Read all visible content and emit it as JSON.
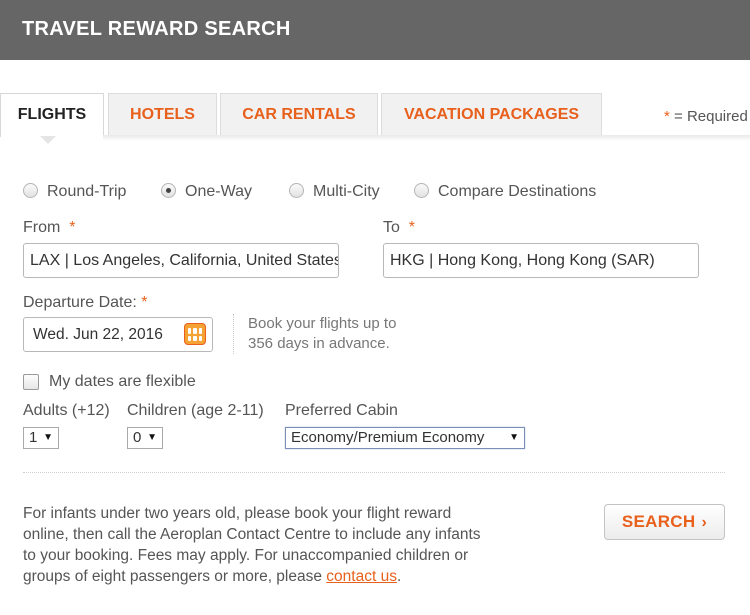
{
  "header": {
    "title": "TRAVEL REWARD SEARCH"
  },
  "tabs": [
    {
      "label": "FLIGHTS",
      "active": true
    },
    {
      "label": "HOTELS",
      "active": false
    },
    {
      "label": "CAR RENTALS",
      "active": false
    },
    {
      "label": "VACATION PACKAGES",
      "active": false
    }
  ],
  "required_note": {
    "star": "*",
    "text": " = Required"
  },
  "trip_types": [
    {
      "label": "Round-Trip",
      "checked": false
    },
    {
      "label": "One-Way",
      "checked": true
    },
    {
      "label": "Multi-City",
      "checked": false
    },
    {
      "label": "Compare Destinations",
      "checked": false
    }
  ],
  "from": {
    "label": "From",
    "star": "*",
    "value": "LAX | Los Angeles, California, United States"
  },
  "to": {
    "label": "To",
    "star": "*",
    "value": "HKG | Hong Kong, Hong Kong (SAR)"
  },
  "departure": {
    "label": "Departure Date:",
    "star": "*",
    "value": "Wed. Jun 22, 2016"
  },
  "advance_note": {
    "line1": "Book your flights up to",
    "line2": "356 days in advance."
  },
  "flexible": {
    "label": "My dates are flexible",
    "checked": false
  },
  "adults": {
    "label": "Adults (+12)",
    "value": "1"
  },
  "children": {
    "label": "Children (age 2-11)",
    "value": "0"
  },
  "cabin": {
    "label": "Preferred Cabin",
    "value": "Economy/Premium Economy"
  },
  "info": {
    "text": "For infants under two years old, please book your flight reward online, then call the Aeroplan Contact Centre to include any infants to your booking. Fees may apply. For unaccompanied children or groups of eight passengers or more, please ",
    "link": "contact us",
    "end": "."
  },
  "search_button": {
    "label": "SEARCH",
    "chevron": "›"
  },
  "colors": {
    "accent": "#e8601c",
    "header_bg": "#666666"
  }
}
